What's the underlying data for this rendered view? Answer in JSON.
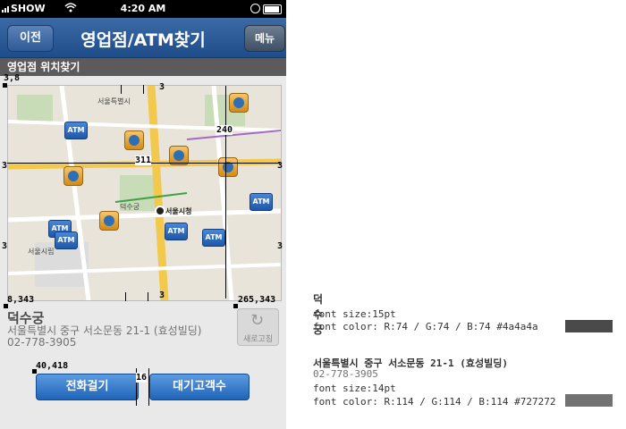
{
  "status_bar": {
    "carrier": "SHOW",
    "time": "4:20 AM"
  },
  "nav": {
    "back_label": "이전",
    "title": "영업점/ATM찾기",
    "menu_label": "메뉴"
  },
  "section_title": "영업점 위치찾기",
  "map": {
    "atm_label": "ATM",
    "current_location_label": "서울시청"
  },
  "branch": {
    "name": "덕수궁",
    "address": "서울특별시 중구 서소문동 21-1 (효성빌딩)",
    "phone": "02-778-3905"
  },
  "refresh_label": "새로고침",
  "buttons": {
    "call": "전화걸기",
    "queue": "대기고객수"
  },
  "annotations": {
    "top_left": "3,8",
    "top_gap": "3",
    "map_width": "311",
    "map_height": "240",
    "side_left": "3",
    "side_right": "3",
    "bottom_gap": "3",
    "map_bottom_left": "8,343",
    "map_bottom_right": "265,343",
    "buttons_origin": "40,418",
    "buttons_gap": "16"
  },
  "spec": {
    "name_sample": "덕수궁",
    "name_size": "font size:15pt",
    "name_color": "font color: R:74 / G:74 / B:74  #4a4a4a",
    "addr_sample": "서울특별시 중구 서소문동 21-1 (효성빌딩)",
    "phone_sample": "02-778-3905",
    "addr_size": "font size:14pt",
    "addr_color": "font color: R:114 / G:114 / B:114  #727272",
    "swatch1": "#4a4a4a",
    "swatch2": "#727272"
  }
}
